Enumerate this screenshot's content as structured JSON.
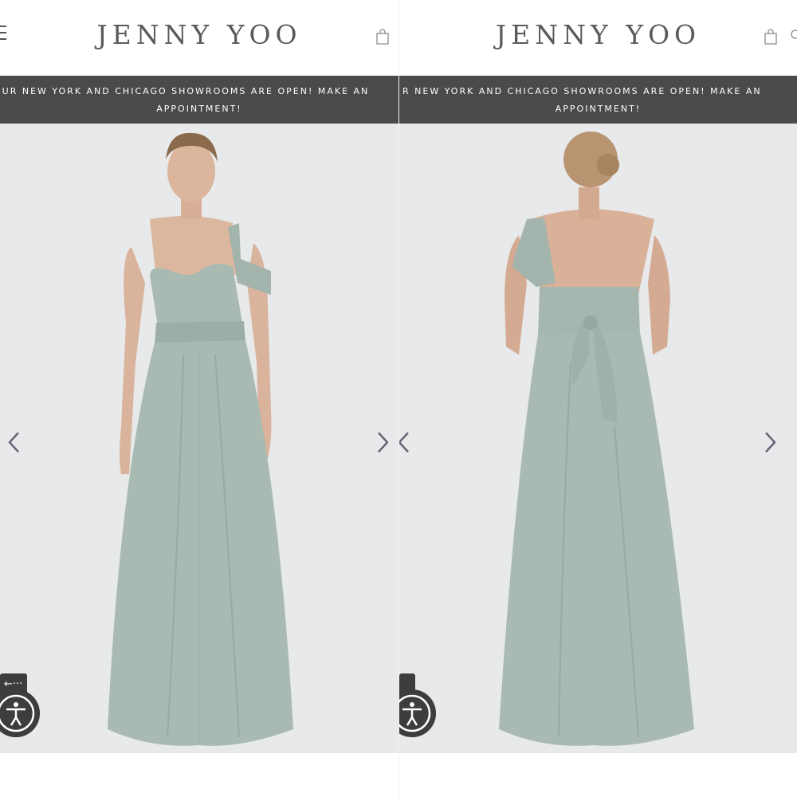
{
  "brand": {
    "logo": "JENNY YOO"
  },
  "banner": {
    "line1_left": "OUR NEW YORK AND CHICAGO SHOWROOMS ARE OPEN! MAKE AN",
    "line1_right": "R NEW YORK AND CHICAGO SHOWROOMS ARE OPEN! MAKE AN",
    "line2": "APPOINTMENT!"
  },
  "icons": {
    "menu": "menu-icon",
    "bag": "shopping-bag-icon",
    "search": "search-icon",
    "prev": "chevron-left-icon",
    "next": "chevron-right-icon",
    "accessibility": "accessibility-icon",
    "toggle": "arrow-left-icon"
  },
  "toggle_label": "←···",
  "gallery": {
    "panels": [
      {
        "view": "front"
      },
      {
        "view": "back"
      }
    ]
  },
  "colors": {
    "banner_bg": "#4a4a4a",
    "dress": "#a9bab3",
    "photo_bg": "#e7e9ea",
    "logo": "#5a5a5a"
  }
}
